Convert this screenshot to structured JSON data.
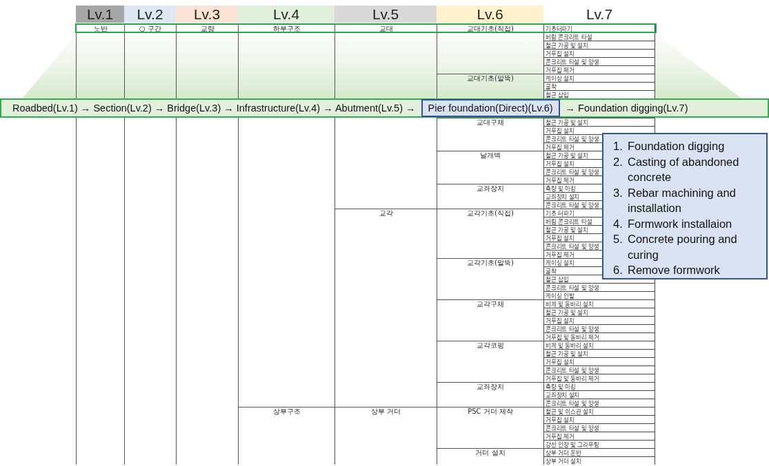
{
  "levels": [
    {
      "label": "Lv.1",
      "color": "#a6a6a6"
    },
    {
      "label": "Lv.2",
      "color": "#dde8f4"
    },
    {
      "label": "Lv.3",
      "color": "#fbe3d5"
    },
    {
      "label": "Lv.4",
      "color": "#e1f0da"
    },
    {
      "label": "Lv.5",
      "color": "#d9d9d9"
    },
    {
      "label": "Lv.6",
      "color": "#fff2cc"
    },
    {
      "label": "Lv.7",
      "color": "#ffffff"
    }
  ],
  "path_row": [
    "노반",
    "○ 구간",
    "교량",
    "하부구조",
    "교대",
    "교대기초(직접)",
    "기초터파기"
  ],
  "upper_table": [
    {
      "items": [
        "버림 콘크리트 타설",
        "철근 가공 및 설치",
        "거푸집 설치",
        "콘크리트 타설 및 양생",
        "거푸집 제거"
      ]
    },
    {
      "label": "교대기초(말뚝)",
      "items": [
        "케이싱 설치",
        "굴착",
        "철근 삽입"
      ]
    }
  ],
  "banner": [
    {
      "text": "Roadbed(Lv.1) → Section(Lv.2) → Bridge(Lv.3) → Infrastructure(Lv.4) → Abutment(Lv.5) →",
      "highlighted": false
    },
    {
      "text": "Pier foundation(Direct)(Lv.6)",
      "highlighted": true
    },
    {
      "text": "→ Foundation digging(Lv.7)",
      "highlighted": false
    }
  ],
  "lower_table": [
    {
      "children": [
        {
          "children": [
            {
              "label": "교대구체",
              "items": [
                "철근 가공 및 설치",
                "거푸집 설치",
                "콘크리트 타설 및 양생",
                "거푸집 제거"
              ]
            },
            {
              "label": "날개벽",
              "items": [
                "철근 가공 및 설치",
                "거푸집 설치",
                "콘크리트 타설 및 양생",
                "거푸집 제거"
              ]
            },
            {
              "label": "교좌장치",
              "items": [
                "측량 및 마킹",
                "교좌장치 설치",
                "콘크리트 타설 및 양생"
              ]
            }
          ]
        },
        {
          "label": "교각",
          "children": [
            {
              "label": "교각기초(직접)",
              "items": [
                "기초 터파기",
                "버림 콘크리트 타설",
                "철근 가공 및 설치",
                "거푸집 설치",
                "콘크리트 타설 및 양생",
                "거푸집 제거"
              ]
            },
            {
              "label": "교각기초(말뚝)",
              "items": [
                "케이싱 설치",
                "굴착",
                "철근 삽입",
                "콘크리트 타설 및 양생",
                "케이싱 인발"
              ]
            },
            {
              "label": "교각구체",
              "items": [
                "비계 및 동바리 설치",
                "철근 가공 및 설치",
                "거푸집 설치",
                "콘크리트 타설 및 양생",
                "거푸집 및 동바리 제거"
              ]
            },
            {
              "label": "교각코핑",
              "items": [
                "비계 및 동바리 설치",
                "철근 가공 및 설치",
                "거푸집 설치",
                "콘크리트 타설 및 양생",
                "거푸집 및 동바리 제거"
              ]
            },
            {
              "label": "교좌장치",
              "items": [
                "측량 및 마킹",
                "교좌장치 설치",
                "콘크리트 타설 및 양생"
              ]
            }
          ]
        }
      ]
    },
    {
      "label": "상부구조",
      "children": [
        {
          "label": "상부 거더",
          "children": [
            {
              "label": "PSC 거더 제작",
              "items": [
                "철근 및 쉬스관 설치",
                "거푸집 설치",
                "콘크리트 타설 및 양생",
                "거푸집 제거",
                "강선 인장 및 그라우팅"
              ]
            },
            {
              "label": "거더 설치",
              "items": [
                "상부 거더 운반",
                "상부 거더 설치"
              ]
            }
          ]
        }
      ]
    }
  ],
  "callout": [
    {
      "number": "1.",
      "text": "Foundation digging"
    },
    {
      "number": "2.",
      "text": "Casting of abandoned concrete"
    },
    {
      "number": "3.",
      "text": "Rebar machining and installation"
    },
    {
      "number": "4.",
      "text": "Formwork installaion"
    },
    {
      "number": "5.",
      "text": "Concrete pouring and curing"
    },
    {
      "number": "6.",
      "text": "Remove formwork"
    }
  ]
}
